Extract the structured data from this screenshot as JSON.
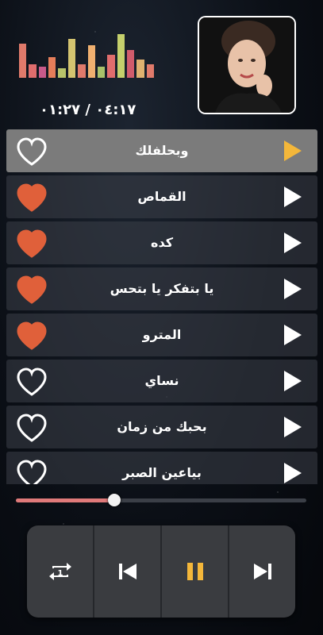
{
  "player": {
    "elapsed": "٠١:٢٧",
    "separator": " / ",
    "duration": "٠٤:١٧",
    "progress_fraction": 0.34
  },
  "equalizer": {
    "bars": [
      {
        "level": 0.75,
        "color": "#e07a6b"
      },
      {
        "level": 0.3,
        "color": "#e06d6d"
      },
      {
        "level": 0.25,
        "color": "#c85a8a"
      },
      {
        "level": 0.45,
        "color": "#e67e5a"
      },
      {
        "level": 0.2,
        "color": "#b8c46a"
      },
      {
        "level": 0.85,
        "color": "#d4c470"
      },
      {
        "level": 0.3,
        "color": "#e07a6b"
      },
      {
        "level": 0.7,
        "color": "#f0b070"
      },
      {
        "level": 0.25,
        "color": "#a9c26a"
      },
      {
        "level": 0.5,
        "color": "#e06d6d"
      },
      {
        "level": 0.95,
        "color": "#c5d06c"
      },
      {
        "level": 0.6,
        "color": "#d05c6c"
      },
      {
        "level": 0.4,
        "color": "#e0b270"
      },
      {
        "level": 0.3,
        "color": "#e07a6b"
      }
    ]
  },
  "songs": [
    {
      "title": "وبحلفلك",
      "liked": false,
      "active": true
    },
    {
      "title": "القماص",
      "liked": true,
      "active": false
    },
    {
      "title": "كده",
      "liked": true,
      "active": false
    },
    {
      "title": "يا بتفكر يا بتحس",
      "liked": true,
      "active": false
    },
    {
      "title": "المترو",
      "liked": true,
      "active": false
    },
    {
      "title": "نساي",
      "liked": false,
      "active": false
    },
    {
      "title": "بحبك من زمان",
      "liked": false,
      "active": false
    },
    {
      "title": "بياعين الصبر",
      "liked": false,
      "active": false
    }
  ],
  "colors": {
    "heart_filled": "#e0603a",
    "active_play": "#f4b73a",
    "pause_icon": "#f4b73a"
  },
  "controls": [
    {
      "icon": "repeat-one-icon"
    },
    {
      "icon": "previous-icon"
    },
    {
      "icon": "pause-icon"
    },
    {
      "icon": "next-icon"
    }
  ]
}
